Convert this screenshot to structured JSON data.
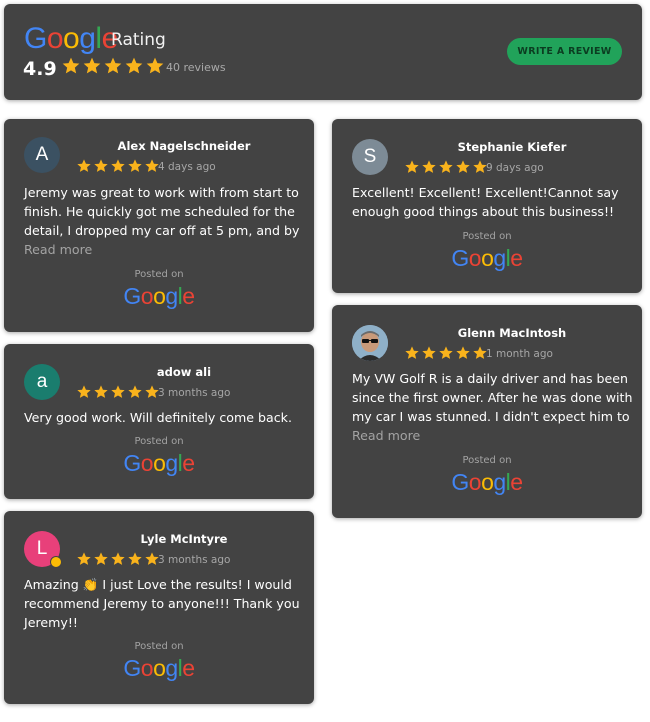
{
  "header": {
    "logo_letters": [
      "G",
      "o",
      "o",
      "g",
      "l",
      "e"
    ],
    "rating_word": "Rating",
    "average": "4.9",
    "review_count": "40 reviews",
    "write_review_label": "WRITE A REVIEW",
    "stars": 5
  },
  "brand_colors": {
    "blue": "#4285F4",
    "red": "#EA4335",
    "yellow": "#FBBC05",
    "green": "#34A853",
    "star": "#F9B31C",
    "card_bg": "#434343",
    "button": "#21A35A"
  },
  "reviews": [
    {
      "initial": "A",
      "avatar_color": "#3b5162",
      "name": "Alex Nagelschneider",
      "stars": 5,
      "time": "4 days ago",
      "text": "Jeremy was great to work with from start to\nfinish. He quickly got me scheduled for the\ndetail, I dropped my car off at 5 pm, and by",
      "read_more": "Read more",
      "posted_on": "Posted on"
    },
    {
      "initial": "a",
      "avatar_color": "#1a7d6e",
      "name": "adow ali",
      "stars": 5,
      "time": "3 months ago",
      "text": "Very good work. Will definitely come back.",
      "posted_on": "Posted on"
    },
    {
      "initial": "L",
      "avatar_color": "#e8407a",
      "name": "Lyle McIntyre",
      "stars": 5,
      "time": "3 months ago",
      "text": "Amazing 👏  I just Love the results! I would\nrecommend Jeremy to anyone!!! Thank you\nJeremy!!",
      "posted_on": "Posted on"
    },
    {
      "initial": "S",
      "avatar_color": "#7d8b96",
      "name": "Stephanie Kiefer",
      "stars": 5,
      "time": "9 days ago",
      "text": "Excellent! Excellent! Excellent!Cannot say\nenough good things about this business!!",
      "posted_on": "Posted on"
    },
    {
      "initial": "",
      "avatar_color": "#8fb0c8",
      "name": "Glenn MacIntosh",
      "stars": 5,
      "time": "1 month ago",
      "text": "My VW Golf R is a daily driver and has been\nsince the first owner. After he was done with\nmy car I was stunned. I didn't expect him to",
      "read_more": "Read more",
      "posted_on": "Posted on"
    }
  ]
}
